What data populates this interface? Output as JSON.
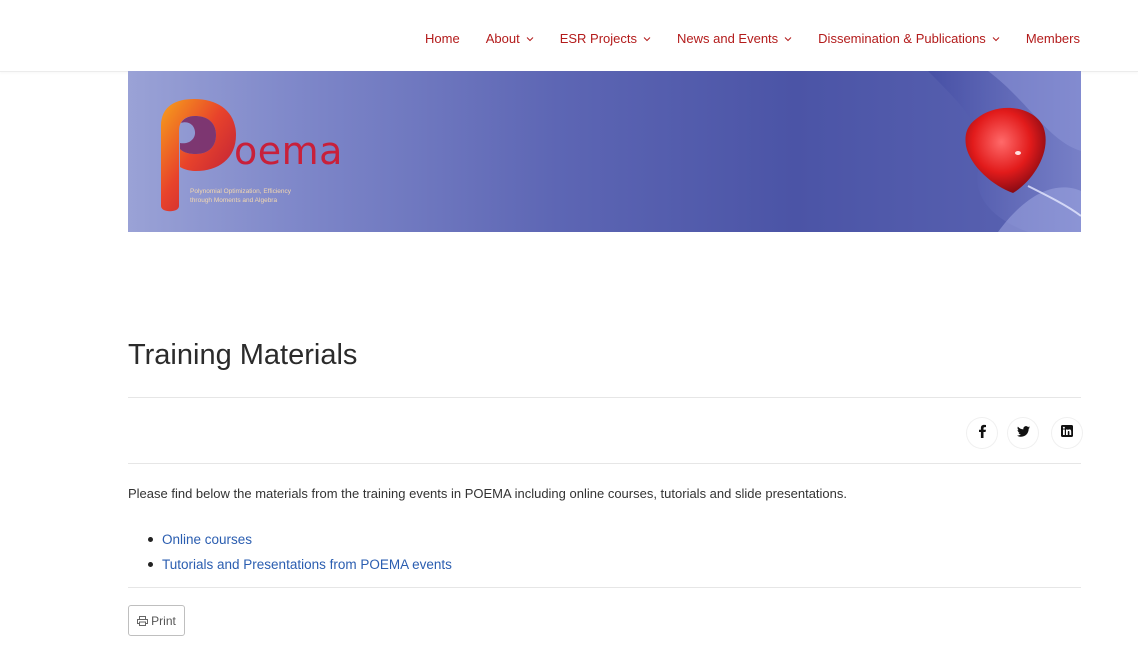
{
  "nav": {
    "items": [
      {
        "label": "Home",
        "has_dropdown": false
      },
      {
        "label": "About",
        "has_dropdown": true
      },
      {
        "label": "ESR Projects",
        "has_dropdown": true
      },
      {
        "label": "News and Events",
        "has_dropdown": true
      },
      {
        "label": "Dissemination & Publications",
        "has_dropdown": true
      },
      {
        "label": "Members",
        "has_dropdown": false
      }
    ],
    "color": "#b31b1b"
  },
  "banner": {
    "logo_word": "oema",
    "logo_tagline_line1": "Polynomial Optimization, Efficiency",
    "logo_tagline_line2": "through Moments and Algebra"
  },
  "page": {
    "title": "Training Materials",
    "intro": "Please find below the materials from the training events in POEMA including online courses, tutorials and slide presentations.",
    "links": [
      "Online courses",
      "Tutorials and Presentations from POEMA events"
    ],
    "print_label": "Print"
  },
  "share": {
    "icons": [
      "facebook-icon",
      "twitter-icon",
      "linkedin-icon"
    ]
  }
}
